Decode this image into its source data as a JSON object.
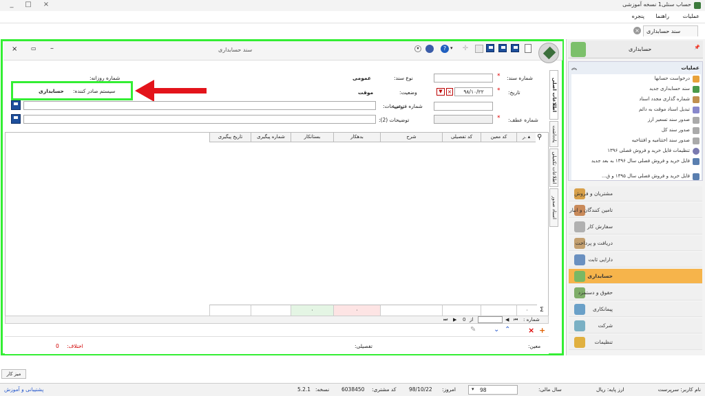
{
  "app": {
    "title": "حساب سنلی1 نسخه آموزشی",
    "minimize_glyph": "_",
    "maximize_glyph": "□",
    "close_glyph": "×"
  },
  "menu": [
    "عملیات",
    "راهنما",
    "پنجره"
  ],
  "doc_tab": {
    "label": "سند حسابداری",
    "close_glyph": "×"
  },
  "window": {
    "title": "سند حسابداری",
    "controls": {
      "close": "×",
      "restore": "▭",
      "minimize": "–"
    }
  },
  "form": {
    "voucher_number_label": "شماره سند:",
    "voucher_type_label": "نوع سند:",
    "voucher_type_value": "عمومی",
    "daily_number_label": "شماره روزانه:",
    "date_label": "تاریخ:",
    "date_value": "۹۸/۱۰/۲۲",
    "status_label": "وضعیت:",
    "status_value": "موقت",
    "issuer_label": "سیستم صادر کننده:",
    "issuer_value": "حسابداری",
    "sub_number_label": "شماره فرعی:",
    "description_label": "توضیحات:",
    "reference_label": "شماره عطف:",
    "description2_label": "توضیحات (2):",
    "required_mark": "*"
  },
  "side_tabs": [
    "اطلاعات اصلی",
    "یادداشت",
    "اطلاعات تکمیلی",
    "اسناد صدور"
  ],
  "grid": {
    "columns": [
      "ر.",
      "کد معین",
      "کد تفصیلی",
      "شرح",
      "بدهکار",
      "بستانکار",
      "شماره پیگیری",
      "تاریخ پیگیری"
    ],
    "sigma": "Σ",
    "sum_first": "۰",
    "sum_debit": "۰",
    "sum_credit": "۰"
  },
  "pager": {
    "label": ": شماره",
    "of": "از",
    "total": "0"
  },
  "summary": {
    "moein_label": "معین:",
    "tafsili_label": "تفصیلی:",
    "diff_label": "اختلاف:",
    "diff_value": "0"
  },
  "sidebar": {
    "header": "حسابداری",
    "pin_glyph": "📌",
    "ops_title": "عملیات",
    "ops_items": [
      "درخواست حسابها",
      "سند حسابداری جدید",
      "شماره گذاری مجدد اسناد",
      "تبدیل اسناد موقت به دائم",
      "صدور سند تسعیر ارز",
      "صدور سند کل",
      "صدور سند اختتامیه و افتتاحیه",
      "تنظیمات فایل خرید و فروش فصلی ۱۳۹۶",
      "فایل خرید و فروش فصلی سال ۱۳۹۶ به بعد جدید",
      "فایل خرید و فروش فصلی سال ۱۳۹۵ و ق..."
    ],
    "nav": [
      "مشتریان و فروش",
      "تامین کنندگان و انبار",
      "سفارش کار",
      "دریافت و پرداخت",
      "دارایی ثابت",
      "حسابداری",
      "حقوق و دستمزد",
      "پیمانکاری",
      "شرکت",
      "تنظیمات"
    ],
    "active_nav": 5
  },
  "bottom_tab": "میز کار",
  "status": {
    "user": "نام کاربر: سرپرست",
    "base_currency": "ارز پایه: ریال",
    "fiscal_year_label": "سال مالی:",
    "fiscal_year_value": "98",
    "today_label": "امروز:",
    "today_value": "98/10/22",
    "customer_code_label": "کد مشتری:",
    "customer_code_value": "6038450",
    "version_label": "نسخه:",
    "version_value": "5.2.1",
    "support_link": "پشتیبانی و آموزش"
  },
  "colors": {
    "highlight_frame": "#33ee33",
    "arrow": "#e3141b",
    "active_nav": "#f6b44b",
    "link": "#2255cc",
    "diff_value": "#d00000"
  }
}
